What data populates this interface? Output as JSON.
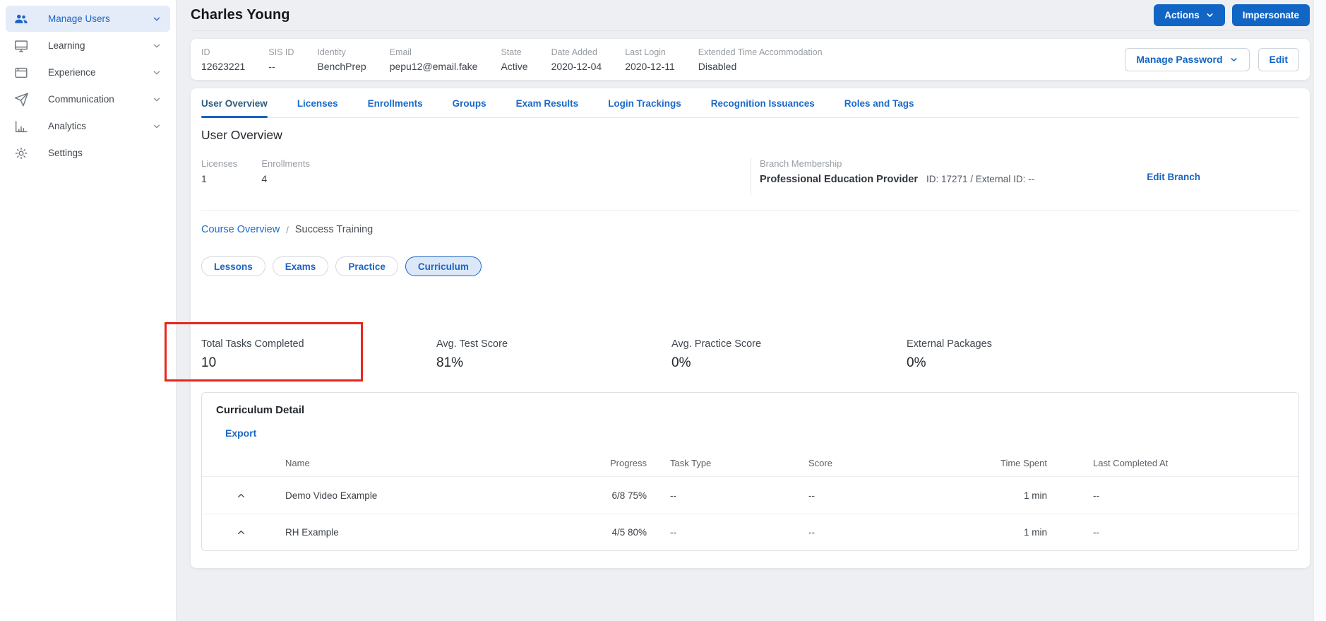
{
  "colors": {
    "accent_blue": "#1165c4",
    "link_blue": "#1b6ac9",
    "annotation_red": "#e8261d",
    "active_tab": "#2e5c80"
  },
  "sidebar": {
    "items": [
      {
        "label": "Manage Users",
        "icon": "users-icon",
        "active": true,
        "has_chevron": true
      },
      {
        "label": "Learning",
        "icon": "monitor-icon",
        "active": false,
        "has_chevron": true
      },
      {
        "label": "Experience",
        "icon": "window-icon",
        "active": false,
        "has_chevron": true
      },
      {
        "label": "Communication",
        "icon": "paper-plane-icon",
        "active": false,
        "has_chevron": true
      },
      {
        "label": "Analytics",
        "icon": "bar-chart-icon",
        "active": false,
        "has_chevron": true
      },
      {
        "label": "Settings",
        "icon": "gear-icon",
        "active": false,
        "has_chevron": false
      }
    ]
  },
  "header": {
    "title": "Charles Young",
    "actions_label": "Actions",
    "impersonate_label": "Impersonate"
  },
  "user_info": {
    "fields": [
      {
        "label": "ID",
        "value": "12623221"
      },
      {
        "label": "SIS ID",
        "value": "--"
      },
      {
        "label": "Identity",
        "value": "BenchPrep"
      },
      {
        "label": "Email",
        "value": "pepu12@email.fake"
      },
      {
        "label": "State",
        "value": "Active"
      },
      {
        "label": "Date Added",
        "value": "2020-12-04"
      },
      {
        "label": "Last Login",
        "value": "2020-12-11"
      },
      {
        "label": "Extended Time Accommodation",
        "value": "Disabled"
      }
    ],
    "manage_password_label": "Manage Password",
    "edit_label": "Edit"
  },
  "tabs": [
    {
      "label": "User Overview",
      "active": true
    },
    {
      "label": "Licenses",
      "active": false
    },
    {
      "label": "Enrollments",
      "active": false
    },
    {
      "label": "Groups",
      "active": false
    },
    {
      "label": "Exam Results",
      "active": false
    },
    {
      "label": "Login Trackings",
      "active": false
    },
    {
      "label": "Recognition Issuances",
      "active": false
    },
    {
      "label": "Roles and Tags",
      "active": false
    }
  ],
  "overview": {
    "heading": "User Overview",
    "counts": [
      {
        "label": "Licenses",
        "value": "1"
      },
      {
        "label": "Enrollments",
        "value": "4"
      }
    ],
    "branch": {
      "label": "Branch Membership",
      "name": "Professional Education Provider",
      "ids": "ID: 17271 / External ID: --",
      "edit_label": "Edit Branch"
    }
  },
  "course": {
    "breadcrumb": {
      "parent": "Course Overview",
      "separator": "/",
      "current": "Success Training"
    },
    "pills": [
      {
        "label": "Lessons",
        "active": false
      },
      {
        "label": "Exams",
        "active": false
      },
      {
        "label": "Practice",
        "active": false
      },
      {
        "label": "Curriculum",
        "active": true
      }
    ],
    "stats": [
      {
        "label": "Total Tasks Completed",
        "value": "10",
        "annotated": true
      },
      {
        "label": "Avg. Test Score",
        "value": "81%",
        "annotated": false
      },
      {
        "label": "Avg. Practice Score",
        "value": "0%",
        "annotated": false
      },
      {
        "label": "External Packages",
        "value": "0%",
        "annotated": false
      }
    ]
  },
  "curriculum_detail": {
    "title": "Curriculum Detail",
    "export_label": "Export",
    "columns": [
      "Name",
      "Progress",
      "Task Type",
      "Score",
      "Time Spent",
      "Last Completed At"
    ],
    "rows": [
      {
        "name": "Demo Video Example",
        "progress": "6/8 75%",
        "task_type": "--",
        "score": "--",
        "time_spent": "1 min",
        "last_completed_at": "--"
      },
      {
        "name": "RH Example",
        "progress": "4/5 80%",
        "task_type": "--",
        "score": "--",
        "time_spent": "1 min",
        "last_completed_at": "--"
      }
    ]
  }
}
